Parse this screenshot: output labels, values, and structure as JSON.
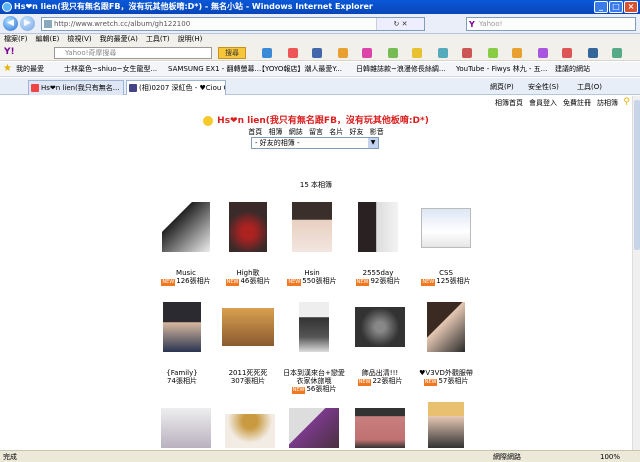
{
  "window": {
    "title": "Hs❤n lien(我只有無名跟FB，沒有玩其他板唷:D*) - 無名小站 - Windows Internet Explorer"
  },
  "address": {
    "url": "http://www.wretch.cc/album/gh122100",
    "search_placeholder": "Yahoo!"
  },
  "menu": [
    "檔案(F)",
    "編輯(E)",
    "檢視(V)",
    "我的最愛(A)",
    "工具(T)",
    "說明(H)"
  ],
  "yahoo_toolbar": {
    "logo": "Y!",
    "search_placeholder": "Yahoo!奇摩搜尋",
    "search_button": "搜尋"
  },
  "favorites": {
    "label": "我的最愛",
    "items": [
      "士林棄色~shiuo~女生龍型...",
      "SAMSUNG EX1 - 翻轉螢幕...",
      "【YOYO報店】潮人最愛Y...",
      "日韓雜誌款~浪漫修長絲綢...",
      "YouTube - Fiwys 林九 - 五...",
      "建議的網站"
    ]
  },
  "tabs": [
    "Hs❤n lien(我只有無名...",
    "(相)0207 深紅色 - ♥Ciou C..."
  ],
  "page_tools": {
    "page": "網頁(P)",
    "safety": "安全性(S)",
    "tools": "工具(O)"
  },
  "site": {
    "toplinks": [
      "相簿首頁",
      "會員登入",
      "免費註冊",
      "訪相簿"
    ],
    "title": "Hs❤n lien(我只有無名跟FB，沒有玩其他板唷:D*)",
    "nav": [
      "首頁",
      "相簿",
      "網誌",
      "留言",
      "名片",
      "好友",
      "影音"
    ],
    "friend_select": "- 好友的相簿 -",
    "album_count": "15 本相簿",
    "albums": [
      {
        "name": "Music",
        "count": "126張相片",
        "new": true
      },
      {
        "name": "High歌",
        "count": "46張相片",
        "new": true
      },
      {
        "name": "Hsin",
        "count": "550張相片",
        "new": true
      },
      {
        "name": "2555day",
        "count": "92張相片",
        "new": true
      },
      {
        "name": "CSS",
        "count": "125張相片",
        "new": true
      },
      {
        "name": "{Family}",
        "count": "74張相片",
        "new": false
      },
      {
        "name": "2011死死死",
        "count": "307張相片",
        "new": false
      },
      {
        "name": "日本到漢來台+戀愛衣家休旅哦",
        "count": "56張相片",
        "new": true
      },
      {
        "name": "飾品出清!!!",
        "count": "22張相片",
        "new": true
      },
      {
        "name": "♥V3VD外觀服帶",
        "count": "57張相片",
        "new": true
      }
    ]
  },
  "status": {
    "left": "完成",
    "zone": "網際網路",
    "zoom": "100%"
  },
  "colors": {
    "title_red": "#d9201f",
    "new_badge": "#f07820",
    "titlebar": "#0a58d8"
  }
}
